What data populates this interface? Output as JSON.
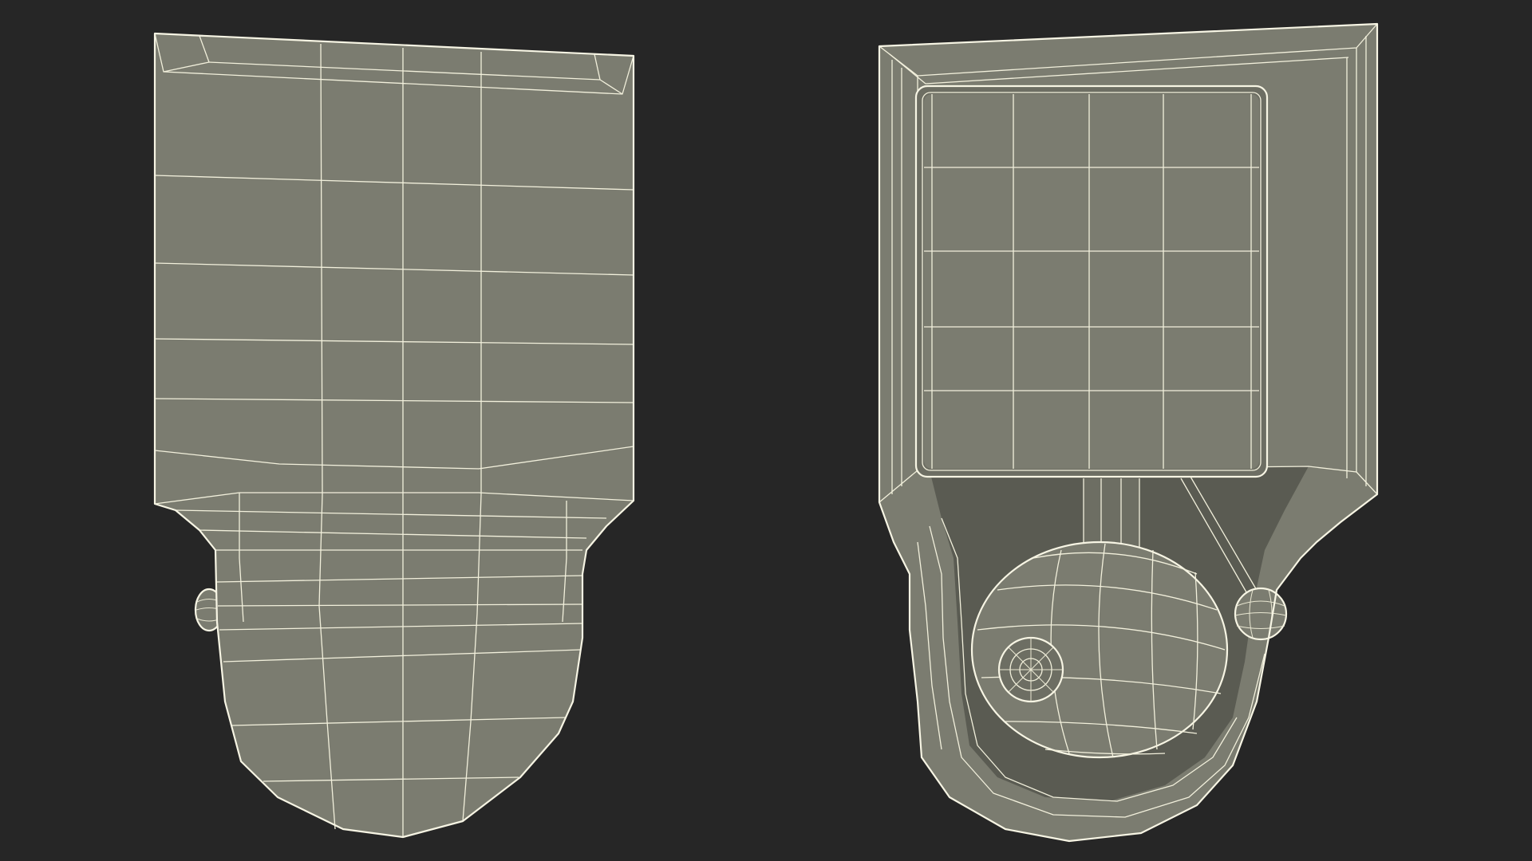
{
  "scene": {
    "background_color": "#262626",
    "mesh_fill_color": "#7b7c70",
    "wire_color": "#f2f0dc",
    "views": [
      {
        "name": "back-view",
        "description_icon": "wireframe-back-icon"
      },
      {
        "name": "front-view",
        "description_icon": "wireframe-front-icon"
      }
    ]
  }
}
